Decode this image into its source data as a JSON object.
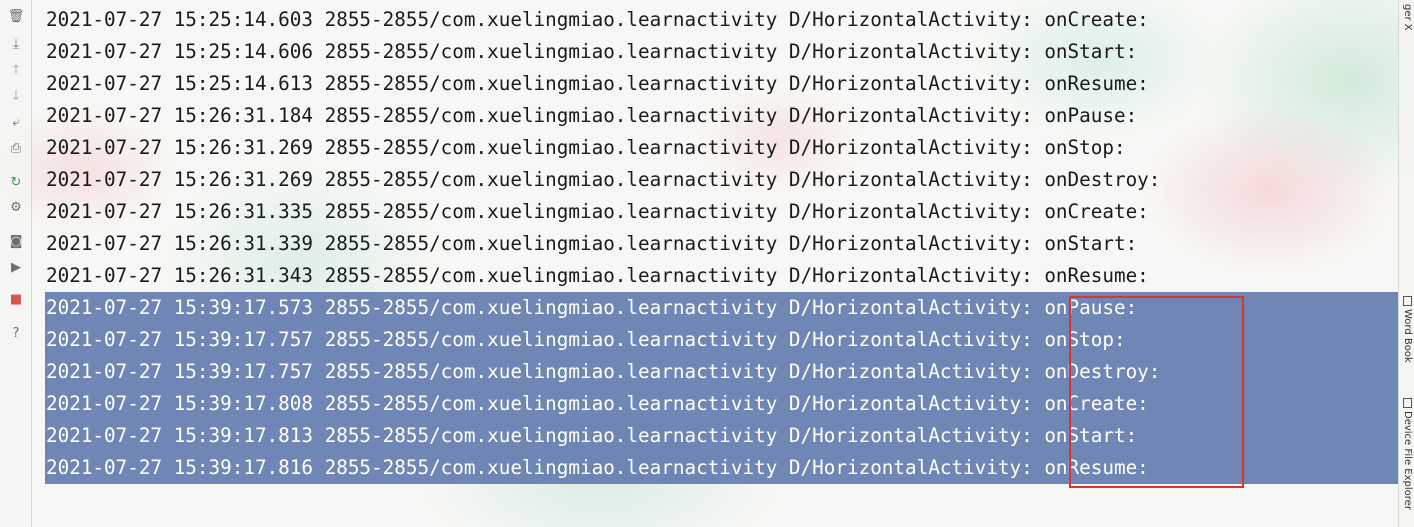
{
  "toolbar": {
    "tools": [
      {
        "name": "trash-icon",
        "glyph": "🗑",
        "enabled": true
      },
      {
        "name": "scroll-to-end-icon",
        "glyph": "⤓",
        "enabled": true
      },
      {
        "name": "up-arrow-icon",
        "glyph": "↑",
        "enabled": false
      },
      {
        "name": "down-arrow-icon",
        "glyph": "↓",
        "enabled": false
      },
      {
        "name": "soft-wrap-icon",
        "glyph": "⤶",
        "enabled": true
      },
      {
        "name": "print-icon",
        "glyph": "⎙",
        "enabled": true
      },
      {
        "name": "restart-icon",
        "glyph": "↻",
        "enabled": true
      },
      {
        "name": "settings-icon",
        "glyph": "⚙",
        "enabled": true
      },
      {
        "name": "screenshot-icon",
        "glyph": "◙",
        "enabled": true
      },
      {
        "name": "screen-record-icon",
        "glyph": "▶",
        "enabled": true
      },
      {
        "name": "stop-icon",
        "glyph": "■",
        "enabled": true
      },
      {
        "name": "help-icon",
        "glyph": "?",
        "enabled": true
      }
    ]
  },
  "right_tabs": {
    "top": "ger X",
    "word_book": "Word Book",
    "device_file_explorer": "Device File Explorer"
  },
  "log": {
    "lines": [
      "2021-07-27 15:25:14.603 2855-2855/com.xuelingmiao.learnactivity D/HorizontalActivity: onCreate:",
      "2021-07-27 15:25:14.606 2855-2855/com.xuelingmiao.learnactivity D/HorizontalActivity: onStart:",
      "2021-07-27 15:25:14.613 2855-2855/com.xuelingmiao.learnactivity D/HorizontalActivity: onResume:",
      "2021-07-27 15:26:31.184 2855-2855/com.xuelingmiao.learnactivity D/HorizontalActivity: onPause:",
      "2021-07-27 15:26:31.269 2855-2855/com.xuelingmiao.learnactivity D/HorizontalActivity: onStop:",
      "2021-07-27 15:26:31.269 2855-2855/com.xuelingmiao.learnactivity D/HorizontalActivity: onDestroy:",
      "2021-07-27 15:26:31.335 2855-2855/com.xuelingmiao.learnactivity D/HorizontalActivity: onCreate:",
      "2021-07-27 15:26:31.339 2855-2855/com.xuelingmiao.learnactivity D/HorizontalActivity: onStart:",
      "2021-07-27 15:26:31.343 2855-2855/com.xuelingmiao.learnactivity D/HorizontalActivity: onResume:",
      "2021-07-27 15:39:17.573 2855-2855/com.xuelingmiao.learnactivity D/HorizontalActivity: onPause:",
      "2021-07-27 15:39:17.757 2855-2855/com.xuelingmiao.learnactivity D/HorizontalActivity: onStop:",
      "2021-07-27 15:39:17.757 2855-2855/com.xuelingmiao.learnactivity D/HorizontalActivity: onDestroy:",
      "2021-07-27 15:39:17.808 2855-2855/com.xuelingmiao.learnactivity D/HorizontalActivity: onCreate:",
      "2021-07-27 15:39:17.813 2855-2855/com.xuelingmiao.learnactivity D/HorizontalActivity: onStart:",
      "2021-07-27 15:39:17.816 2855-2855/com.xuelingmiao.learnactivity D/HorizontalActivity: onResume:"
    ],
    "selected_lines": [
      9,
      10,
      11,
      12,
      13,
      14
    ]
  },
  "colors": {
    "selection": "#5d76ac",
    "annotation_box": "#e03131",
    "text": "#1a1a1a",
    "selected_text": "#ffffff"
  }
}
